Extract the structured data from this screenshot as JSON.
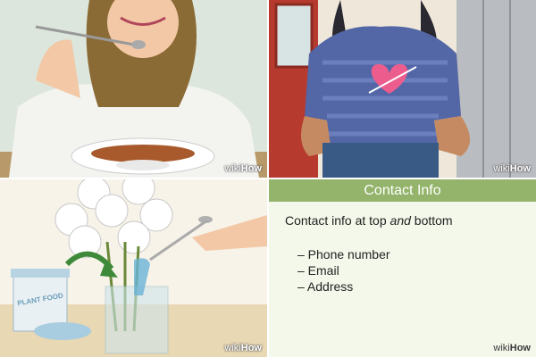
{
  "watermark": {
    "wiki": "wiki",
    "how": "How"
  },
  "contact_card": {
    "title": "Contact Info",
    "subtitle_pre": "Contact info at top ",
    "subtitle_em": "and",
    "subtitle_post": " bottom",
    "items": [
      "– Phone number",
      "– Email",
      "– Address"
    ]
  },
  "plant_food_label": "PLANT FOOD",
  "colors": {
    "header_green": "#93b46a",
    "shirt_blue": "#5366a6",
    "heart_pink": "#ec5d8e",
    "soup_orange": "#a85a2c"
  }
}
